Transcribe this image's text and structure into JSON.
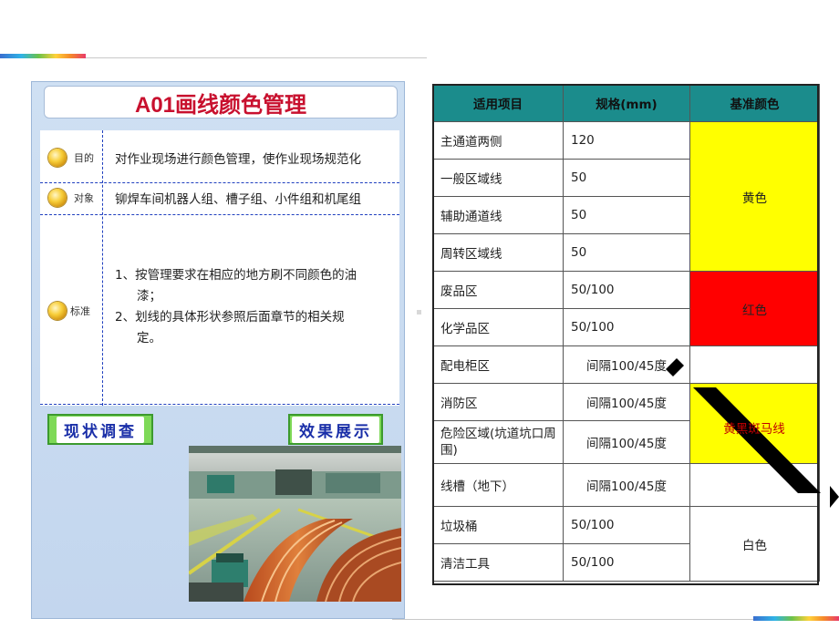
{
  "left": {
    "title": "A01画线颜色管理",
    "rows": [
      {
        "label": "目的",
        "text": "对作业现场进行颜色管理，使作业现场规范化"
      },
      {
        "label": "对象",
        "text": "铆焊车间机器人组、槽子组、小件组和机尾组"
      },
      {
        "label": "标准",
        "lines": [
          "1、按管理要求在相应的地方刷不同颜色的油",
          "漆；",
          "2、划线的具体形状参照后面章节的相关规",
          "定。"
        ]
      }
    ],
    "buttons": {
      "current": "现状调查",
      "result": "效果展示"
    }
  },
  "table": {
    "headers": [
      "适用项目",
      "规格(mm)",
      "基准颜色"
    ],
    "rows": [
      {
        "item": "主通道两侧",
        "spec": "120"
      },
      {
        "item": "一般区域线",
        "spec": "50"
      },
      {
        "item": "辅助通道线",
        "spec": "50"
      },
      {
        "item": "周转区域线",
        "spec": "50"
      },
      {
        "item": "废品区",
        "spec": "50/100"
      },
      {
        "item": "化学品区",
        "spec": "50/100"
      },
      {
        "item": "配电柜区",
        "spec": "间隔100/45度"
      },
      {
        "item": "消防区",
        "spec": "间隔100/45度"
      },
      {
        "item": "危险区域(坑道坑口周围)",
        "spec": "间隔100/45度"
      },
      {
        "item": "线槽（地下）",
        "spec": "间隔100/45度"
      },
      {
        "item": "垃圾桶",
        "spec": "50/100"
      },
      {
        "item": "清洁工具",
        "spec": "50/100"
      }
    ],
    "colors": {
      "yellow_label": "黄色",
      "red_label": "红色",
      "stripe_label": "黄黑斑马线",
      "white_label": "白色"
    },
    "header_bg": "#1b8c8c",
    "yellow_hex": "#ffff00",
    "red_hex": "#ff0000"
  }
}
